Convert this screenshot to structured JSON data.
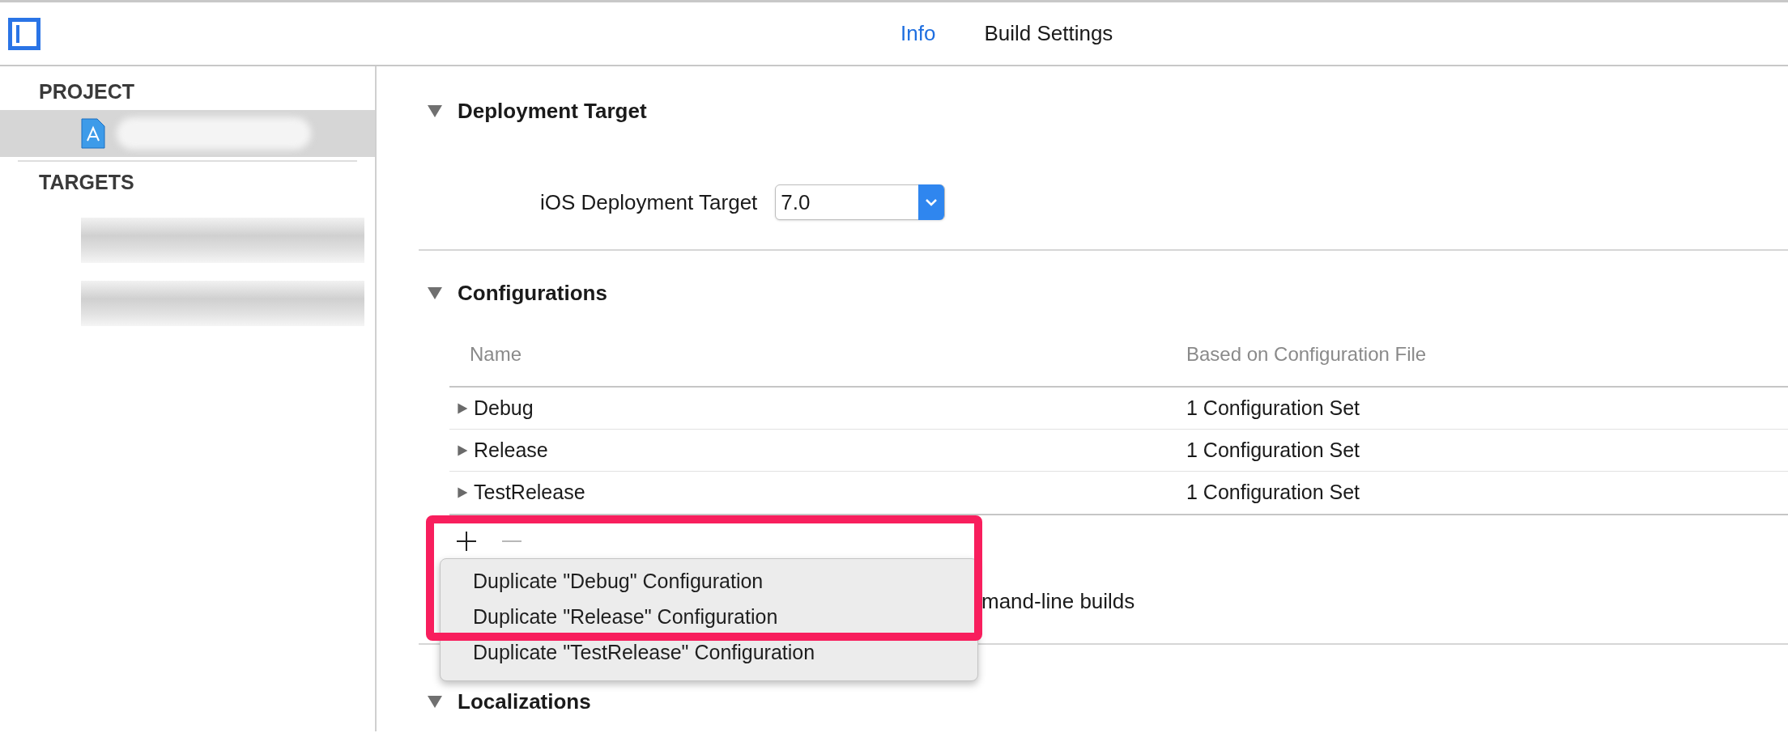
{
  "toolbar": {
    "tabs": [
      {
        "label": "Info",
        "selected": true
      },
      {
        "label": "Build Settings",
        "selected": false
      }
    ]
  },
  "sidebar": {
    "sections": [
      {
        "heading": "PROJECT",
        "items": [
          {
            "kind": "project",
            "selected": true
          }
        ]
      },
      {
        "heading": "TARGETS",
        "items": [
          {
            "kind": "target",
            "selected": false
          },
          {
            "kind": "target",
            "selected": false
          }
        ]
      }
    ]
  },
  "deployment": {
    "title": "Deployment Target",
    "expanded": true,
    "field_label": "iOS Deployment Target",
    "value": "7.0"
  },
  "configurations": {
    "title": "Configurations",
    "expanded": true,
    "columns": [
      "Name",
      "Based on Configuration File"
    ],
    "rows": [
      {
        "name": "Debug",
        "based_on": "1 Configuration Set",
        "expanded": false
      },
      {
        "name": "Release",
        "based_on": "1 Configuration Set",
        "expanded": false
      },
      {
        "name": "TestRelease",
        "based_on": "1 Configuration Set",
        "expanded": false
      }
    ],
    "remove_enabled": false,
    "command_line_text": "mand-line builds"
  },
  "menu": {
    "items": [
      {
        "label": "Duplicate \"Debug\" Configuration"
      },
      {
        "label": "Duplicate \"Release\" Configuration"
      },
      {
        "label": "Duplicate \"TestRelease\" Configuration"
      }
    ]
  },
  "localizations": {
    "title": "Localizations",
    "expanded": true
  }
}
